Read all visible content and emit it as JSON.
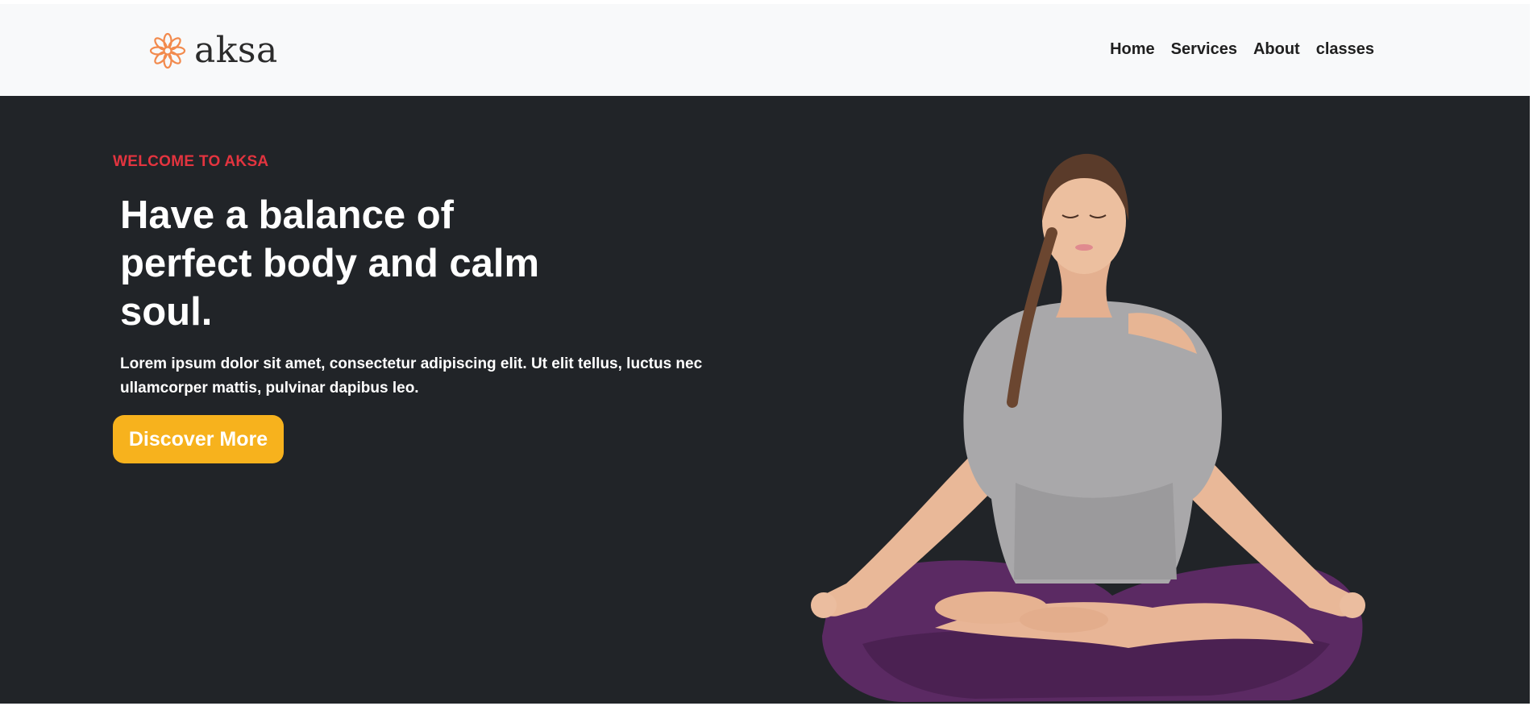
{
  "brand": {
    "name": "aksa",
    "icon": "flower-icon"
  },
  "nav": {
    "items": [
      "Home",
      "Services",
      "About",
      "classes"
    ]
  },
  "hero": {
    "eyebrow": "WELCOME TO AKSA",
    "title_lines": [
      "Have a balance of",
      "perfect body and calm",
      "soul."
    ],
    "lead_lines": [
      "Lorem ipsum dolor sit amet, consectetur adipiscing elit. Ut elit tellus, luctus nec",
      "ullamcorper mattis, pulvinar dapibus leo."
    ],
    "cta_label": "Discover More",
    "image": "meditating-woman-illustration"
  },
  "colors": {
    "navbar_bg": "#f8f9fa",
    "hero_bg": "#212428",
    "accent_red": "#e3343f",
    "cta_yellow": "#f7b21d",
    "brand_orange": "#f28a4d"
  }
}
